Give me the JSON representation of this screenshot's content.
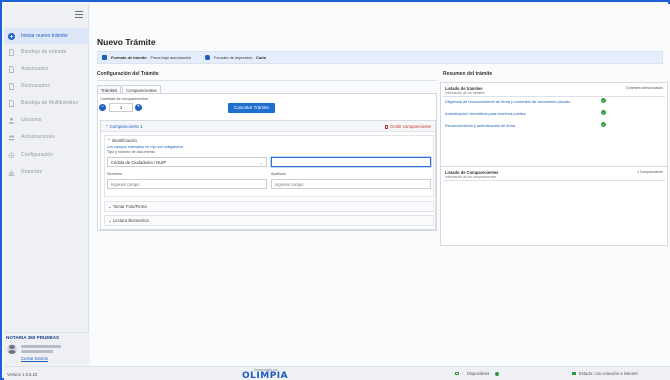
{
  "window": {
    "minimize": "–",
    "maximize": "□",
    "close": "✕"
  },
  "sidebar": {
    "items": [
      {
        "label": "Iniciar nuevo trámite",
        "icon": "plus-circle-icon"
      },
      {
        "label": "Bandeja de entrada",
        "icon": "document-icon"
      },
      {
        "label": "Autorizados",
        "icon": "document-icon"
      },
      {
        "label": "Rechazados",
        "icon": "document-icon"
      },
      {
        "label": "Bandeja de Multitrámites",
        "icon": "document-icon"
      },
      {
        "label": "Usuarios",
        "icon": "user-icon"
      },
      {
        "label": "Autorizaciones",
        "icon": "users-icon"
      },
      {
        "label": "Configuración",
        "icon": "gear-icon"
      },
      {
        "label": "Reportes",
        "icon": "chart-icon"
      }
    ],
    "notaria": "NOTARIA 360 PRUEBAS",
    "logout": "Cerrar Sesión"
  },
  "main": {
    "title": "Nuevo Trámite",
    "info": {
      "format_key": "Formato de trámite:",
      "format_val": "Firma bajo autorización",
      "print_key": "Formato de impresión:",
      "print_val": "Carta"
    },
    "config_title": "Configuración del Trámite",
    "summary_title": "Resumen del trámite",
    "tabs": [
      "Trámites",
      "Comparecientes"
    ],
    "qty_label": "Cantidad de comparecientes",
    "qty_value": "1",
    "cancel_label": "Cancelar Trámite",
    "compareciente": {
      "title": "Compareciente 1",
      "delete_label": "Omitir compareciente",
      "ident_title": "Identificación",
      "required_note": "Los campos marcados en rojo son obligatorios",
      "doc_label": "Tipo y número de documento",
      "doc_select": "Cédula de Ciudadanía / NUIP",
      "doc_number": "",
      "nombres_label": "Nombres",
      "nombres_ph": "Ingresar campo",
      "apellidos_label": "Apellidos",
      "apellidos_ph": "Ingresar campo",
      "foto_label": "Tomar Foto/Firma",
      "bio_label": "Lectura Biometrica"
    }
  },
  "summary": {
    "tramites": {
      "title": "Listado de trámites",
      "subtitle": "Información de los trámites",
      "count": "3 trámites seleccionados",
      "items": [
        "Diligencia de reconocimiento de firma y contenido de documento privado",
        "Autenticación biométrica para escritura pública",
        "Reconocimiento y autenticación de firma"
      ]
    },
    "comparecientes": {
      "title": "Listado de Comparecientes",
      "subtitle": "Información de los comparecientes",
      "count": "1 Compareciente"
    }
  },
  "status": {
    "version": "Version 1.0.6.22",
    "powered": "Desarrollado por",
    "brand": "OLIMPIA",
    "devices": "Dispositivos",
    "connection": "Estado: con conexión a internet"
  },
  "colors": {
    "accent": "#1f5fbf",
    "ok": "#2c9a3e",
    "border": "#1c5fd6"
  }
}
